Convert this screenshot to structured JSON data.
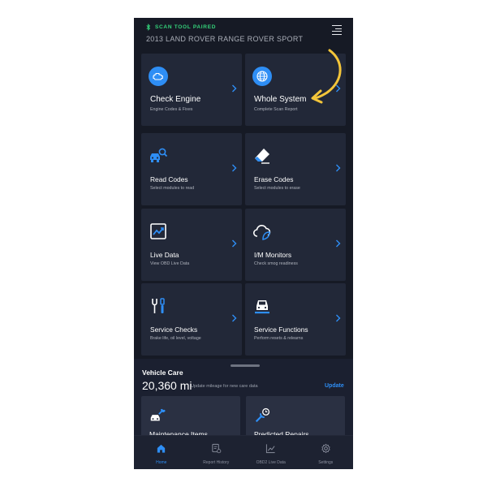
{
  "colors": {
    "accent": "#2e8ef5",
    "paired": "#34d27a",
    "arrow": "#f3c53a",
    "background": "#161a25",
    "tile": "#222838"
  },
  "header": {
    "status": "SCAN TOOL PAIRED",
    "status_icon": "bluetooth-icon",
    "vehicle": "2013 LAND ROVER RANGE ROVER SPORT",
    "menu_icon": "menu-icon"
  },
  "tiles": [
    {
      "title": "Check Engine",
      "subtitle": "Engine Codes & Fixes",
      "icon": "engine-icon"
    },
    {
      "title": "Whole System",
      "subtitle": "Complete Scan Report",
      "icon": "globe-icon"
    },
    {
      "title": "Read Codes",
      "subtitle": "Select modules to read",
      "icon": "car-search-icon"
    },
    {
      "title": "Erase Codes",
      "subtitle": "Select modules to erase",
      "icon": "eraser-icon"
    },
    {
      "title": "Live Data",
      "subtitle": "View OBD Live Data",
      "icon": "chart-icon"
    },
    {
      "title": "I/M Monitors",
      "subtitle": "Check smog readiness",
      "icon": "cloud-leaf-icon"
    },
    {
      "title": "Service Checks",
      "subtitle": "Brake life, oil level, voltage",
      "icon": "tools-icon"
    },
    {
      "title": "Service Functions",
      "subtitle": "Perform resets & relearns",
      "icon": "car-lift-icon"
    }
  ],
  "vehicle_care": {
    "title": "Vehicle Care",
    "mileage": "20,360 mi",
    "mileage_note": "Update mileage for new care data",
    "update_label": "Update",
    "cards": [
      {
        "title": "Maintenance Items",
        "icon": "car-wrench-icon"
      },
      {
        "title": "Predicted Repairs",
        "icon": "wrench-clock-icon"
      }
    ]
  },
  "nav": [
    {
      "label": "Home",
      "icon": "home-icon",
      "active": true
    },
    {
      "label": "Report History",
      "icon": "report-icon",
      "active": false
    },
    {
      "label": "OBD2 Live Data",
      "icon": "line-chart-icon",
      "active": false
    },
    {
      "label": "Settings",
      "icon": "gear-icon",
      "active": false
    }
  ]
}
